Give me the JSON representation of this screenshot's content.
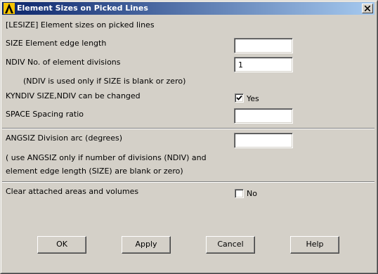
{
  "window": {
    "title": "Element Sizes on Picked Lines",
    "icon": "ansys-logo-icon",
    "close_icon": "close-icon"
  },
  "dialog": {
    "header": "[LESIZE]  Element sizes on picked lines",
    "size_label": "SIZE    Element edge length",
    "size_value": "",
    "ndiv_label": "NDIV    No. of element divisions",
    "ndiv_value": "1",
    "ndiv_note": "(NDIV is used only if SIZE is blank or zero)",
    "kyndiv_label": "KYNDIV  SIZE,NDIV can be changed",
    "kyndiv_checked": true,
    "kyndiv_text": "Yes",
    "space_label": "SPACE   Spacing ratio",
    "space_value": "",
    "angsiz_label": "ANGSIZ  Division arc (degrees)",
    "angsiz_value": "",
    "angsiz_note_1": "( use ANGSIZ only if number of divisions (NDIV) and",
    "angsiz_note_2": "element edge length (SIZE) are blank or zero)",
    "clear_label": "Clear attached areas and volumes",
    "clear_checked": false,
    "clear_text": "No"
  },
  "buttons": {
    "ok": "OK",
    "apply": "Apply",
    "cancel": "Cancel",
    "help": "Help"
  }
}
